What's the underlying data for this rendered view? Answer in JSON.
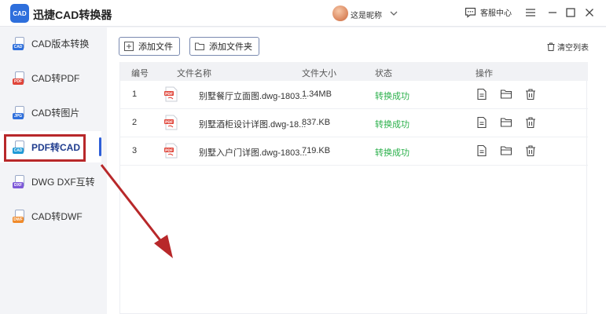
{
  "app": {
    "logo_text": "CAD",
    "title": "迅捷CAD转换器",
    "username": "这是昵称",
    "service_label": "客服中心"
  },
  "sidebar": {
    "items": [
      {
        "label": "CAD版本转换",
        "tag": "CAD",
        "tag_color": "#2e6fdc",
        "icon": "cad-version-icon"
      },
      {
        "label": "CAD转PDF",
        "tag": "PDF",
        "tag_color": "#e0453a",
        "icon": "cad-to-pdf-icon"
      },
      {
        "label": "CAD转图片",
        "tag": "JPG",
        "tag_color": "#2e6fdc",
        "icon": "cad-to-image-icon"
      },
      {
        "label": "PDF转CAD",
        "tag": "CAD",
        "tag_color": "#1f9ad6",
        "icon": "pdf-to-cad-icon"
      },
      {
        "label": "DWG DXF互转",
        "tag": "DXF",
        "tag_color": "#7d58d8",
        "icon": "dwg-dxf-icon"
      },
      {
        "label": "CAD转DWF",
        "tag": "DWF",
        "tag_color": "#f08a2a",
        "icon": "cad-to-dwf-icon"
      }
    ]
  },
  "toolbar": {
    "add_file": "添加文件",
    "add_folder": "添加文件夹",
    "clear_list": "清空列表"
  },
  "table": {
    "headers": [
      "编号",
      "文件名称",
      "文件大小",
      "状态",
      "操作"
    ],
    "rows": [
      {
        "num": "1",
        "name": "别墅餐厅立面图.dwg-1803...",
        "size": "1.34MB",
        "status": "转换成功"
      },
      {
        "num": "2",
        "name": "别墅酒柜设计详图.dwg-18...",
        "size": "837.KB",
        "status": "转换成功"
      },
      {
        "num": "3",
        "name": "别墅入户门详图.dwg-1803...",
        "size": "719.KB",
        "status": "转换成功"
      }
    ]
  },
  "colors": {
    "accent": "#2e5fd8",
    "annotation": "#b8282a",
    "success": "#2bb04b"
  }
}
